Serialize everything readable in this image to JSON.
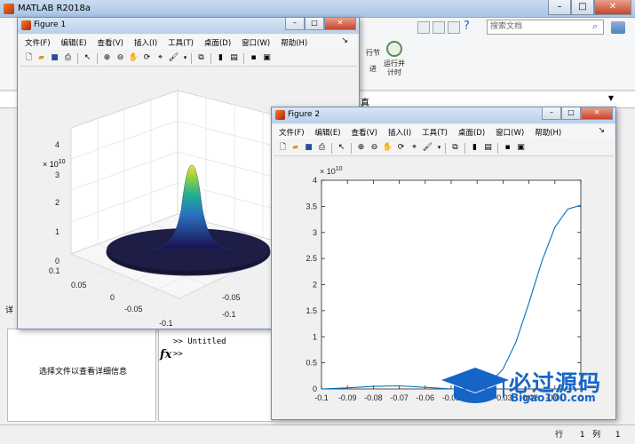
{
  "matlab": {
    "title": "MATLAB R2018a",
    "search_placeholder": "搜索文档",
    "ribbon": {
      "run_section": "行节",
      "advance": "进",
      "run_parallel_line1": "运行并",
      "run_parallel_line2": "计时"
    },
    "address_text": "真",
    "details_text": "选择文件以查看详细信息",
    "command": {
      "line1": ">> Untitled",
      "prompt": ">>"
    },
    "status": {
      "row_label": "行",
      "row_value": "1",
      "col_label": "列",
      "col_value": "1"
    },
    "side_labels": {
      "detail_label": "详"
    }
  },
  "figure1": {
    "title": "Figure 1",
    "menu": [
      "文件(F)",
      "编辑(E)",
      "查看(V)",
      "插入(I)",
      "工具(T)",
      "桌面(D)",
      "窗口(W)",
      "帮助(H)"
    ],
    "axes": {
      "exponent": "10",
      "exponent_base": "× 10",
      "z_ticks": [
        "4",
        "3",
        "2",
        "1",
        "0"
      ],
      "x_ticks": [
        "0.1",
        "0.05",
        "0",
        "-0.05",
        "-0.1"
      ],
      "y_ticks": [
        "-0.05",
        "-0.1"
      ]
    }
  },
  "figure2": {
    "title": "Figure 2",
    "menu": [
      "文件(F)",
      "编辑(E)",
      "查看(V)",
      "插入(I)",
      "工具(T)",
      "桌面(D)",
      "窗口(W)",
      "帮助(H)"
    ]
  },
  "chart_data": {
    "type": "line",
    "title": "",
    "xlabel": "",
    "ylabel": "",
    "y_multiplier": "× 10^10",
    "xlim": [
      -0.1,
      0
    ],
    "ylim": [
      0,
      4
    ],
    "x_ticks": [
      "-0.1",
      "-0.09",
      "-0.08",
      "-0.07",
      "-0.06",
      "-0.05",
      "-0.04",
      "-0.03",
      "-0.02",
      "-0.01",
      "0"
    ],
    "y_ticks": [
      "0",
      "0.5",
      "1",
      "1.5",
      "2",
      "2.5",
      "3",
      "3.5",
      "4"
    ],
    "series": [
      {
        "color": "#0072bd",
        "x": [
          -0.1,
          -0.09,
          -0.08,
          -0.07,
          -0.06,
          -0.05,
          -0.045,
          -0.04,
          -0.035,
          -0.03,
          -0.025,
          -0.02,
          -0.015,
          -0.01,
          -0.005,
          0
        ],
        "y": [
          0,
          0.02,
          0.05,
          0.06,
          0.03,
          -0.02,
          -0.03,
          0.0,
          0.12,
          0.38,
          0.9,
          1.65,
          2.45,
          3.1,
          3.45,
          3.52
        ]
      }
    ],
    "grid": false
  },
  "watermark": {
    "text": "必过源码",
    "url": "Bigao100.com"
  }
}
